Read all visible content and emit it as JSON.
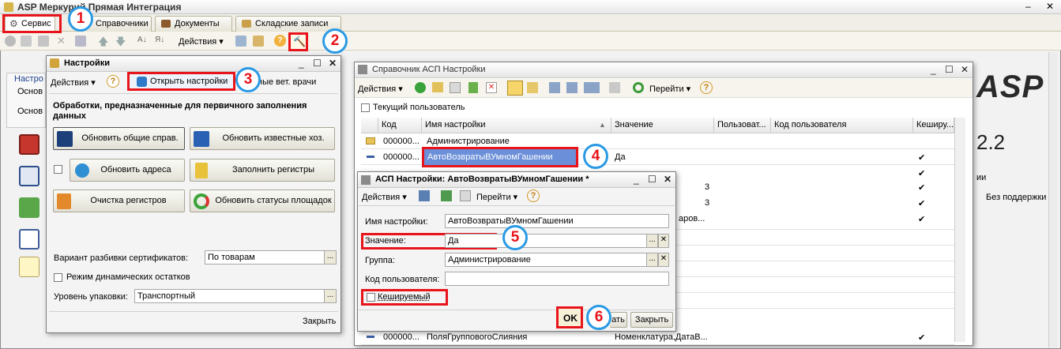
{
  "app": {
    "title": "ASP Меркурий Прямая Интеграция",
    "tabs": [
      {
        "label": "Сервис"
      },
      {
        "label": "Справочники"
      },
      {
        "label": "Документы"
      },
      {
        "label": "Складские записи"
      }
    ],
    "toolbar_actions_label": "Действия",
    "bg_label_nastr": "Настро",
    "bg_label_osnov1": "Основ",
    "bg_label_osnov2": "Основ",
    "logo_text": "ASP",
    "version_text": "2.2",
    "bg_right_text": "Без поддержки",
    "bg_right_header": "ии"
  },
  "settings_window": {
    "title": "Настройки",
    "actions_label": "Действия",
    "open_settings_label": "Открыть настройки",
    "vet_tab_label": "ные вет. врачи",
    "section_title": "Обработки, предназначенные для первичного заполнения данных",
    "buttons": {
      "update_general": "Обновить общие справ.",
      "update_known": "Обновить известные хоз.",
      "update_addresses": "Обновить адреса",
      "fill_registers": "Заполнить регистры",
      "clear_registers": "Очистка регистров",
      "update_site_statuses": "Обновить статусы площадок"
    },
    "cert_split_label": "Вариант разбивки сертификатов:",
    "cert_split_value": "По товарам",
    "dynamic_stock_label": "Режим динамических остатков",
    "packaging_label": "Уровень упаковки:",
    "packaging_value": "Транспортный",
    "close_label": "Закрыть"
  },
  "directory_window": {
    "title": "Справочник АСП Настройки",
    "actions_label": "Действия",
    "goto_label": "Перейти",
    "current_user_label": "Текущий пользователь",
    "columns": [
      "Код",
      "Имя настройки",
      "Значение",
      "Пользоват...",
      "Код пользователя",
      "Кеширу..."
    ],
    "rows": [
      {
        "code": "000000...",
        "name": "Администрирование",
        "value": "",
        "extra": "",
        "cached": ""
      },
      {
        "code": "000000...",
        "name": "АвтоВозвратыВУмномГашении",
        "value": "Да",
        "extra": "",
        "cached": "✔"
      },
      {
        "code": "",
        "name": "",
        "value": "",
        "extra": "",
        "cached": "✔"
      },
      {
        "code": "",
        "name": "",
        "value": "3",
        "extra": "",
        "cached": "✔"
      },
      {
        "code": "",
        "name": "",
        "value": "3",
        "extra": "",
        "cached": "✔"
      },
      {
        "code": "",
        "name": "",
        "value": "аров...",
        "extra": "",
        "cached": "✔"
      },
      {
        "code": "000000...",
        "name": "ПоляГрупповогоСлияния",
        "value": "Номенклатура,ДатаВ...",
        "extra": "",
        "cached": "✔"
      }
    ]
  },
  "edit_window": {
    "title": "АСП Настройки: АвтоВозвратыВУмномГашении *",
    "actions_label": "Действия",
    "goto_label": "Перейти",
    "name_label": "Имя настройки:",
    "name_value": "АвтоВозвратыВУмномГашении",
    "value_label": "Значение:",
    "value_value": "Да",
    "group_label": "Группа:",
    "group_value": "Администрирование",
    "user_code_label": "Код пользователя:",
    "user_code_value": "",
    "cached_label": "Кешируемый",
    "ok_label": "OK",
    "write_label": "ать",
    "close_label": "Закрыть"
  },
  "annotations": {
    "steps": [
      "1",
      "2",
      "3",
      "4",
      "5",
      "6"
    ],
    "highlight_color": "#e8141b",
    "badge_border_color": "#2a9ae4"
  }
}
